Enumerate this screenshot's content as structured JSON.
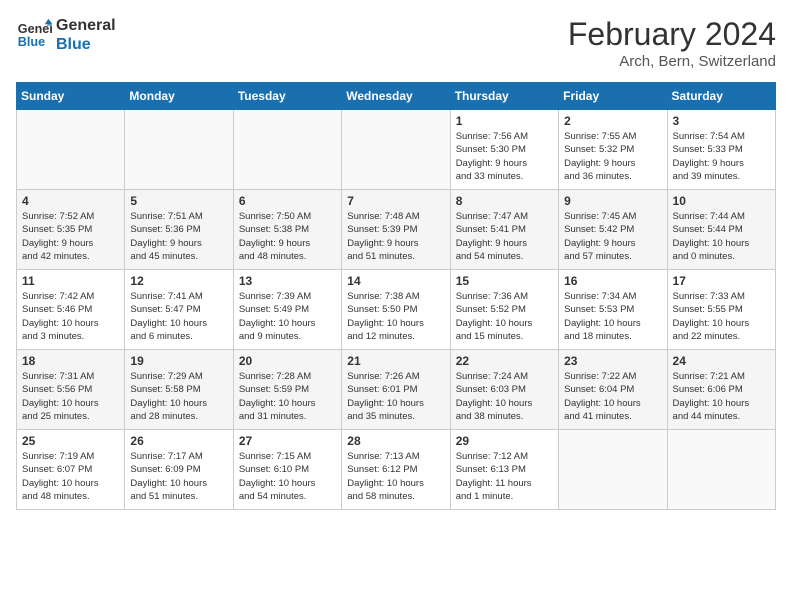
{
  "logo": {
    "line1": "General",
    "line2": "Blue"
  },
  "title": "February 2024",
  "location": "Arch, Bern, Switzerland",
  "weekdays": [
    "Sunday",
    "Monday",
    "Tuesday",
    "Wednesday",
    "Thursday",
    "Friday",
    "Saturday"
  ],
  "weeks": [
    [
      {
        "day": "",
        "info": ""
      },
      {
        "day": "",
        "info": ""
      },
      {
        "day": "",
        "info": ""
      },
      {
        "day": "",
        "info": ""
      },
      {
        "day": "1",
        "info": "Sunrise: 7:56 AM\nSunset: 5:30 PM\nDaylight: 9 hours\nand 33 minutes."
      },
      {
        "day": "2",
        "info": "Sunrise: 7:55 AM\nSunset: 5:32 PM\nDaylight: 9 hours\nand 36 minutes."
      },
      {
        "day": "3",
        "info": "Sunrise: 7:54 AM\nSunset: 5:33 PM\nDaylight: 9 hours\nand 39 minutes."
      }
    ],
    [
      {
        "day": "4",
        "info": "Sunrise: 7:52 AM\nSunset: 5:35 PM\nDaylight: 9 hours\nand 42 minutes."
      },
      {
        "day": "5",
        "info": "Sunrise: 7:51 AM\nSunset: 5:36 PM\nDaylight: 9 hours\nand 45 minutes."
      },
      {
        "day": "6",
        "info": "Sunrise: 7:50 AM\nSunset: 5:38 PM\nDaylight: 9 hours\nand 48 minutes."
      },
      {
        "day": "7",
        "info": "Sunrise: 7:48 AM\nSunset: 5:39 PM\nDaylight: 9 hours\nand 51 minutes."
      },
      {
        "day": "8",
        "info": "Sunrise: 7:47 AM\nSunset: 5:41 PM\nDaylight: 9 hours\nand 54 minutes."
      },
      {
        "day": "9",
        "info": "Sunrise: 7:45 AM\nSunset: 5:42 PM\nDaylight: 9 hours\nand 57 minutes."
      },
      {
        "day": "10",
        "info": "Sunrise: 7:44 AM\nSunset: 5:44 PM\nDaylight: 10 hours\nand 0 minutes."
      }
    ],
    [
      {
        "day": "11",
        "info": "Sunrise: 7:42 AM\nSunset: 5:46 PM\nDaylight: 10 hours\nand 3 minutes."
      },
      {
        "day": "12",
        "info": "Sunrise: 7:41 AM\nSunset: 5:47 PM\nDaylight: 10 hours\nand 6 minutes."
      },
      {
        "day": "13",
        "info": "Sunrise: 7:39 AM\nSunset: 5:49 PM\nDaylight: 10 hours\nand 9 minutes."
      },
      {
        "day": "14",
        "info": "Sunrise: 7:38 AM\nSunset: 5:50 PM\nDaylight: 10 hours\nand 12 minutes."
      },
      {
        "day": "15",
        "info": "Sunrise: 7:36 AM\nSunset: 5:52 PM\nDaylight: 10 hours\nand 15 minutes."
      },
      {
        "day": "16",
        "info": "Sunrise: 7:34 AM\nSunset: 5:53 PM\nDaylight: 10 hours\nand 18 minutes."
      },
      {
        "day": "17",
        "info": "Sunrise: 7:33 AM\nSunset: 5:55 PM\nDaylight: 10 hours\nand 22 minutes."
      }
    ],
    [
      {
        "day": "18",
        "info": "Sunrise: 7:31 AM\nSunset: 5:56 PM\nDaylight: 10 hours\nand 25 minutes."
      },
      {
        "day": "19",
        "info": "Sunrise: 7:29 AM\nSunset: 5:58 PM\nDaylight: 10 hours\nand 28 minutes."
      },
      {
        "day": "20",
        "info": "Sunrise: 7:28 AM\nSunset: 5:59 PM\nDaylight: 10 hours\nand 31 minutes."
      },
      {
        "day": "21",
        "info": "Sunrise: 7:26 AM\nSunset: 6:01 PM\nDaylight: 10 hours\nand 35 minutes."
      },
      {
        "day": "22",
        "info": "Sunrise: 7:24 AM\nSunset: 6:03 PM\nDaylight: 10 hours\nand 38 minutes."
      },
      {
        "day": "23",
        "info": "Sunrise: 7:22 AM\nSunset: 6:04 PM\nDaylight: 10 hours\nand 41 minutes."
      },
      {
        "day": "24",
        "info": "Sunrise: 7:21 AM\nSunset: 6:06 PM\nDaylight: 10 hours\nand 44 minutes."
      }
    ],
    [
      {
        "day": "25",
        "info": "Sunrise: 7:19 AM\nSunset: 6:07 PM\nDaylight: 10 hours\nand 48 minutes."
      },
      {
        "day": "26",
        "info": "Sunrise: 7:17 AM\nSunset: 6:09 PM\nDaylight: 10 hours\nand 51 minutes."
      },
      {
        "day": "27",
        "info": "Sunrise: 7:15 AM\nSunset: 6:10 PM\nDaylight: 10 hours\nand 54 minutes."
      },
      {
        "day": "28",
        "info": "Sunrise: 7:13 AM\nSunset: 6:12 PM\nDaylight: 10 hours\nand 58 minutes."
      },
      {
        "day": "29",
        "info": "Sunrise: 7:12 AM\nSunset: 6:13 PM\nDaylight: 11 hours\nand 1 minute."
      },
      {
        "day": "",
        "info": ""
      },
      {
        "day": "",
        "info": ""
      }
    ]
  ]
}
